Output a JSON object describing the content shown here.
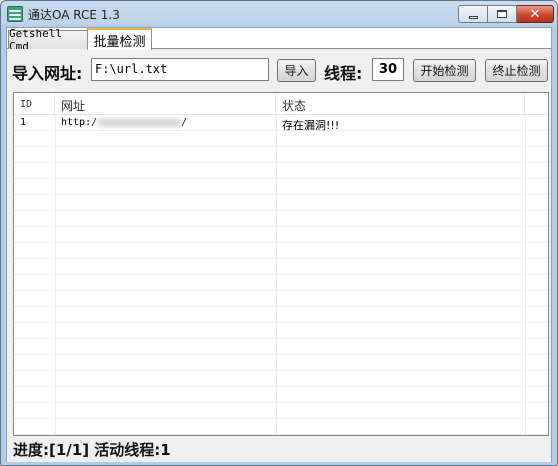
{
  "window": {
    "title": "通达OA RCE 1.3",
    "close_glyph": "✕"
  },
  "tabs": [
    {
      "label": "Getshell Cmd",
      "active": false
    },
    {
      "label": "批量检测",
      "active": true
    }
  ],
  "toolbar": {
    "import_label": "导入网址:",
    "path_value": "F:\\url.txt",
    "import_button": "导入",
    "threads_label": "线程:",
    "threads_value": "30",
    "start_button": "开始检测",
    "stop_button": "终止检测"
  },
  "grid": {
    "columns": [
      "ID",
      "网址",
      "状态"
    ],
    "rows": [
      {
        "id": "1",
        "url_prefix": "http:/",
        "url_suffix": "/",
        "status": "存在漏洞!!!"
      }
    ]
  },
  "status": {
    "text": "进度:[1/1] 活动线程:1"
  },
  "colors": {
    "active_tab_accent": "#f0b43c",
    "close_button": "#c9452c"
  }
}
